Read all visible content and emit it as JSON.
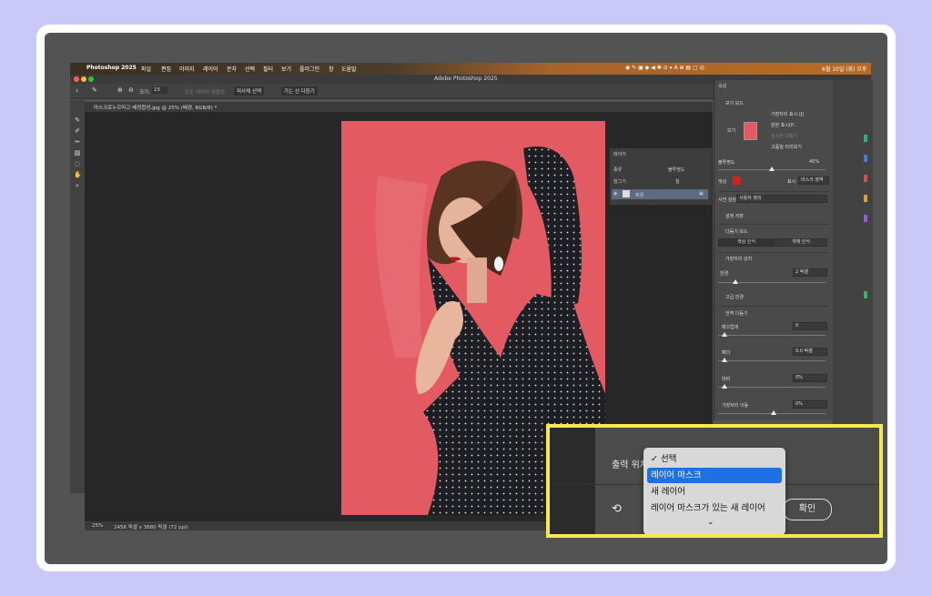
{
  "menubar": {
    "app": "Photoshop 2025",
    "items": [
      "파일",
      "편집",
      "이미지",
      "레이어",
      "문자",
      "선택",
      "필터",
      "보기",
      "플러그인",
      "창",
      "도움말"
    ],
    "clock": "6월 10일 (화) 오후"
  },
  "window": {
    "title": "Adobe Photoshop 2025"
  },
  "options": {
    "size_label": "크기:",
    "size_value": "15",
    "sample_all": "모든 레이어 샘플링",
    "subject_button": "피사체 선택",
    "refine_button": "가는 선 다듬기"
  },
  "document_tab": {
    "label": "마스크로누르따고 배경합성.jpg @ 25% (배경, RGB/8) *"
  },
  "status": {
    "zoom": "25%",
    "info": "2456 픽셀 x 3680 픽셀 (72 ppi)"
  },
  "layers_panel": {
    "title": "레이어",
    "kind": "종류",
    "blend": "불투명도",
    "lock": "잠그기",
    "fill": "칠",
    "layer_name": "배경"
  },
  "properties": {
    "title": "속성",
    "view_mode_heading": "보기 모드",
    "view_label": "보기",
    "show_edge": "가장자리 표시 (J)",
    "show_original": "원본 표시(P...",
    "realtime": "실시간 다듬기",
    "high_quality": "고품질 미리보기",
    "opacity_label": "불투명도",
    "opacity_value": "40%",
    "color_label": "색상",
    "color_value": "#e01b1b",
    "display_label": "표시",
    "display_value": "마스크 영역",
    "preset_label": "사전 설정",
    "preset_value": "사용자 정의",
    "save_settings": "설정 저장",
    "refine_mode_heading": "다듬기 모드",
    "color_aware": "색상 인식",
    "object_aware": "개체 인식",
    "edge_detect_heading": "가장자리 감지",
    "radius_label": "반경",
    "radius_value": "2 픽셀",
    "smart_radius": "고급 반경",
    "global_heading": "전역 다듬기",
    "smooth_label": "매끄럽게",
    "smooth_value": "0",
    "feather_label": "페더",
    "feather_value": "0.0 픽셀",
    "contrast_label": "대비",
    "contrast_value": "0%",
    "shift_label": "가장자리 이동",
    "shift_value": "0%"
  },
  "output": {
    "label": "출력 위치",
    "options": [
      "선택",
      "레이어 마스크",
      "새 레이어",
      "레이어 마스크가 있는 새 레이어"
    ],
    "checked_index": 0,
    "highlighted_index": 1,
    "ok_button": "확인"
  }
}
